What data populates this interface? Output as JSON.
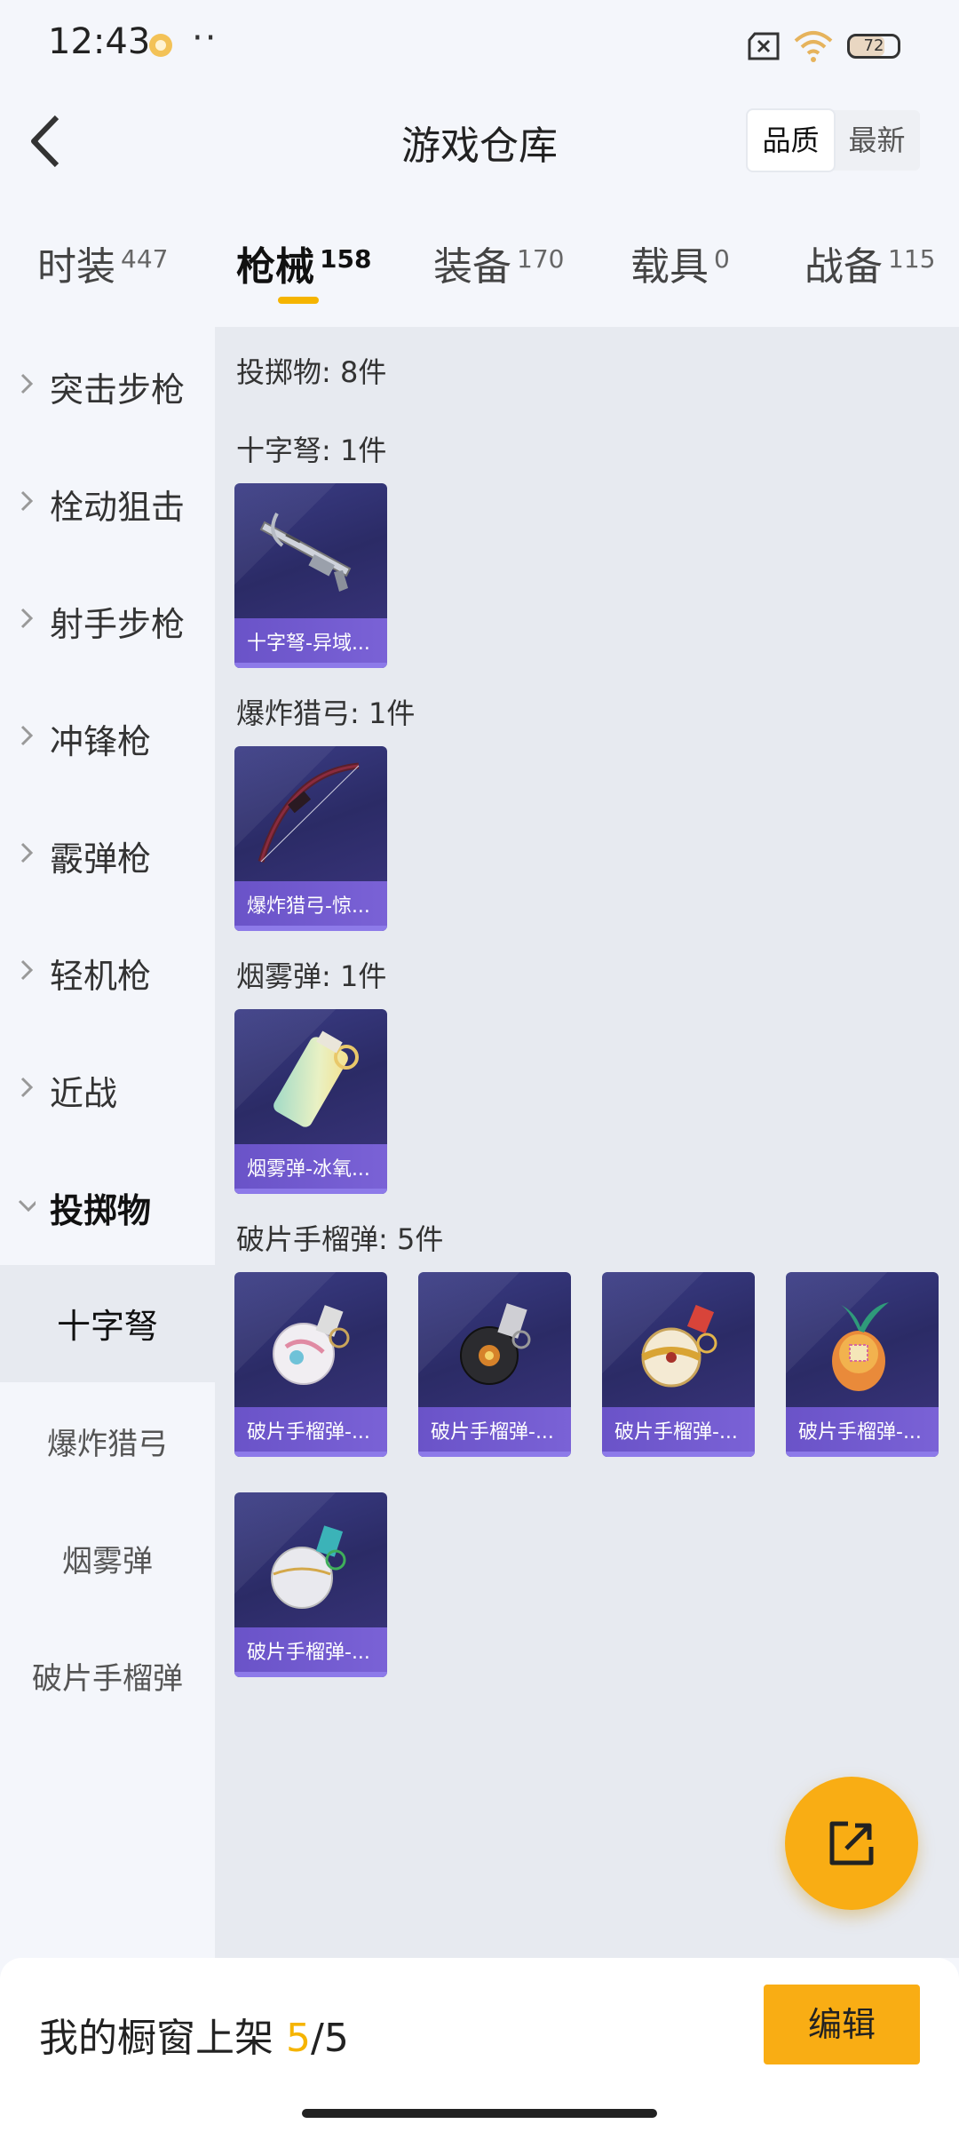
{
  "status_bar": {
    "time": "12:43",
    "more": "··",
    "battery": "72"
  },
  "header": {
    "title": "游戏仓库",
    "sort_options": [
      "品质",
      "最新"
    ],
    "active_sort": "品质"
  },
  "tabs": [
    {
      "label": "时装",
      "count": "447"
    },
    {
      "label": "枪械",
      "count": "158",
      "active": true
    },
    {
      "label": "装备",
      "count": "170"
    },
    {
      "label": "载具",
      "count": "0"
    },
    {
      "label": "战备",
      "count": "115"
    }
  ],
  "sidebar": {
    "categories": [
      "突击步枪",
      "栓动狙击",
      "射手步枪",
      "冲锋枪",
      "霰弹枪",
      "轻机枪",
      "近战",
      "投掷物"
    ],
    "expanded": "投掷物",
    "sub_items": [
      "十字弩",
      "爆炸猎弓",
      "烟雾弹",
      "破片手榴弹"
    ],
    "active_sub": "十字弩"
  },
  "content": {
    "summary": "投掷物: 8件",
    "sections": [
      {
        "title": "十字弩: 1件",
        "items": [
          {
            "name": "十字弩-异域...",
            "icon": "crossbow-icon"
          }
        ]
      },
      {
        "title": "爆炸猎弓: 1件",
        "items": [
          {
            "name": "爆炸猎弓-惊...",
            "icon": "bow-icon"
          }
        ]
      },
      {
        "title": "烟雾弹: 1件",
        "items": [
          {
            "name": "烟雾弹-冰氧...",
            "icon": "smoke-grenade-icon"
          }
        ]
      },
      {
        "title": "破片手榴弹: 5件",
        "items": [
          {
            "name": "破片手榴弹-...",
            "icon": "grenade-icon"
          },
          {
            "name": "破片手榴弹-...",
            "icon": "grenade-icon"
          },
          {
            "name": "破片手榴弹-...",
            "icon": "grenade-icon"
          },
          {
            "name": "破片手榴弹-...",
            "icon": "grenade-icon"
          },
          {
            "name": "破片手榴弹-...",
            "icon": "grenade-icon"
          }
        ]
      }
    ]
  },
  "bottom_bar": {
    "label": "我的橱窗上架",
    "count_current": "5",
    "count_total": "/5",
    "edit_label": "编辑"
  },
  "colors": {
    "accent": "#f9ad14",
    "card_bg": "#2b2b66",
    "card_bar": "#6a53c8"
  }
}
